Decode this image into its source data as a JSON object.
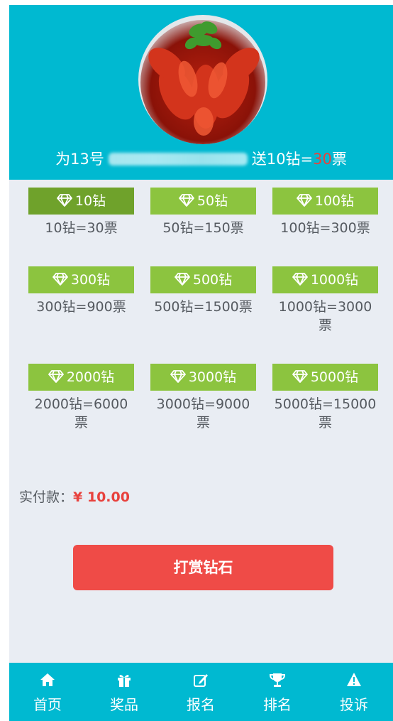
{
  "header": {
    "prefix": "为13号",
    "gift_prefix": "送10钻=",
    "gift_votes": "30",
    "gift_suffix": "票",
    "payment_label": "实付款：",
    "payment_amount": "¥ 10.00"
  },
  "options": [
    {
      "button": "10钻",
      "desc": "10钻=30票"
    },
    {
      "button": "50钻",
      "desc": "50钻=150票"
    },
    {
      "button": "100钻",
      "desc": "100钻=300票"
    },
    {
      "button": "300钻",
      "desc": "300钻=900票"
    },
    {
      "button": "500钻",
      "desc": "500钻=1500票"
    },
    {
      "button": "1000钻",
      "desc": "1000钻=3000票"
    },
    {
      "button": "2000钻",
      "desc": "2000钻=6000票"
    },
    {
      "button": "3000钻",
      "desc": "3000钻=9000票"
    },
    {
      "button": "5000钻",
      "desc": "5000钻=15000票"
    }
  ],
  "submit_label": "打赏钻石",
  "nav": [
    {
      "label": "首页",
      "icon": "home-icon"
    },
    {
      "label": "奖品",
      "icon": "gift-icon"
    },
    {
      "label": "报名",
      "icon": "edit-icon"
    },
    {
      "label": "排名",
      "icon": "trophy-icon"
    },
    {
      "label": "投诉",
      "icon": "warning-icon"
    }
  ],
  "colors": {
    "header_bg": "#00b9d1",
    "option_green": "#8cc43f",
    "option_selected": "#6fa22b",
    "accent_red": "#ef4b47"
  }
}
